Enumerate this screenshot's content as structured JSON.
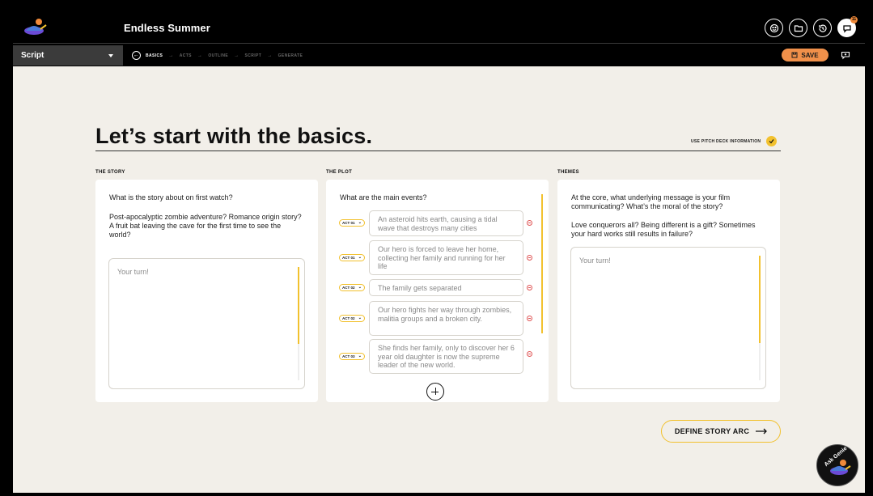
{
  "app": {
    "title": "Endless Summer",
    "notification_count": "11"
  },
  "subnav": {
    "selector_value": "Script",
    "breadcrumbs": [
      "BASICS",
      "ACTS",
      "OUTLINE",
      "SCRIPT",
      "GENERATE"
    ],
    "save_label": "SAVE"
  },
  "page": {
    "heading": "Let’s start with the basics.",
    "pitch_label": "USE PITCH DECK INFORMATION"
  },
  "story": {
    "label": "THE STORY",
    "question": "What is the story about on first watch?",
    "hint": "Post-apocalyptic zombie adventure? Romance origin story? A fruit bat leaving the cave for the first time to see the world?",
    "placeholder": "Your turn!"
  },
  "plot": {
    "label": "THE PLOT",
    "question": "What are the main events?",
    "events": [
      {
        "act": "ACT 01",
        "text": "An asteroid hits earth, causing a tidal wave that destroys many cities"
      },
      {
        "act": "ACT 01",
        "text": "Our hero is forced to leave her home, collecting her family and running for her life"
      },
      {
        "act": "ACT 02",
        "text": "The family gets separated"
      },
      {
        "act": "ACT 02",
        "text": "Our hero fights her way through zombies, malitia groups and a broken city."
      },
      {
        "act": "ACT 03",
        "text": "She finds her family, only to discover her 6 year old daughter is now the supreme leader of the new world."
      }
    ]
  },
  "themes": {
    "label": "THEMES",
    "question": "At the core, what underlying message is your film communicating? What’s the moral of the story?",
    "hint": "Love conquerors all? Being different is a gift? Sometimes your hard works still results in failure?",
    "placeholder": "Your turn!"
  },
  "actions": {
    "define_label": "DEFINE STORY ARC",
    "genie_label": "Ask Genie"
  },
  "colors": {
    "accent_yellow": "#f2c12e",
    "save_orange": "#f0904a",
    "canvas": "#f2efe9"
  }
}
